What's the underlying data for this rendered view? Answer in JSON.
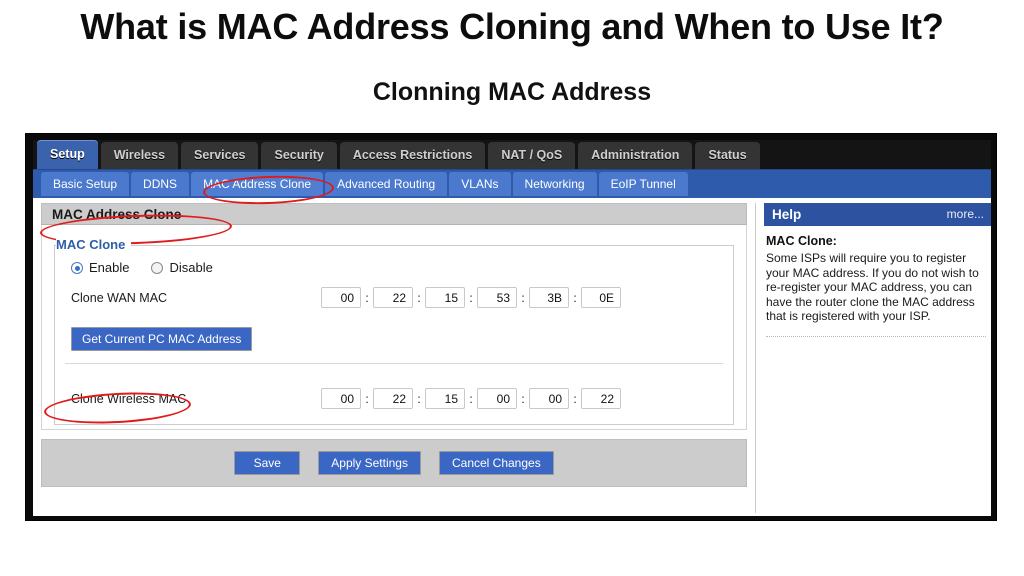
{
  "slide": {
    "title": "What is MAC Address Cloning and When to Use It?",
    "subtitle": "Clonning MAC Address"
  },
  "router": {
    "main_tabs": [
      {
        "label": "Setup",
        "active": true
      },
      {
        "label": "Wireless",
        "active": false
      },
      {
        "label": "Services",
        "active": false
      },
      {
        "label": "Security",
        "active": false
      },
      {
        "label": "Access Restrictions",
        "active": false
      },
      {
        "label": "NAT / QoS",
        "active": false
      },
      {
        "label": "Administration",
        "active": false
      },
      {
        "label": "Status",
        "active": false
      }
    ],
    "sub_tabs": [
      {
        "label": "Basic Setup",
        "active": false
      },
      {
        "label": "DDNS",
        "active": false
      },
      {
        "label": "MAC Address Clone",
        "active": true
      },
      {
        "label": "Advanced Routing",
        "active": false
      },
      {
        "label": "VLANs",
        "active": false
      },
      {
        "label": "Networking",
        "active": false
      },
      {
        "label": "EoIP Tunnel",
        "active": false
      }
    ],
    "section": {
      "header": "MAC Address Clone",
      "fieldset_title": "MAC Clone",
      "radio": {
        "enable_label": "Enable",
        "disable_label": "Disable",
        "selected": "Enable"
      },
      "wan": {
        "label": "Clone WAN MAC",
        "octets": [
          "00",
          "22",
          "15",
          "53",
          "3B",
          "0E"
        ],
        "separator": ":"
      },
      "get_mac_button": "Get Current PC MAC Address",
      "wireless": {
        "label": "Clone Wireless MAC",
        "octets": [
          "00",
          "22",
          "15",
          "00",
          "00",
          "22"
        ],
        "separator": ":"
      }
    },
    "actions": {
      "save": "Save",
      "apply": "Apply Settings",
      "cancel": "Cancel Changes"
    },
    "help": {
      "title": "Help",
      "more": "more...",
      "term": "MAC Clone:",
      "text": "Some ISPs will require you to register your MAC address. If you do not wish to re-register your MAC address, you can have the router clone the MAC address that is registered with your ISP."
    },
    "colors": {
      "active_tab_blue": "#3b62ac",
      "subtab_blue": "#4a79cd",
      "button_blue": "#3a66c4",
      "help_header_blue": "#2c52a0",
      "section_gray": "#cccccc",
      "annotation_red": "#e01b1b"
    }
  }
}
